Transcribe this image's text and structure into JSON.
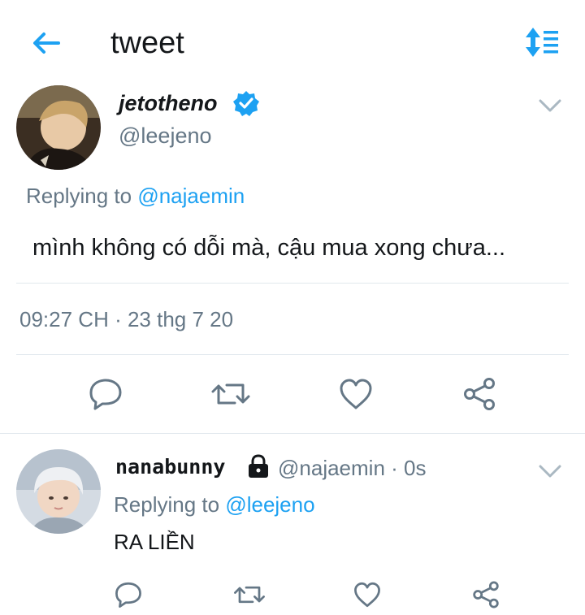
{
  "header": {
    "title": "tweet",
    "back_icon": "back-arrow-icon",
    "sort_icon": "sort-icon",
    "accent_color": "#1da1f2"
  },
  "tweet": {
    "display_name": "jetotheno",
    "handle": "@leejeno",
    "verified": true,
    "replying_prefix": "Replying to ",
    "replying_to": "@najaemin",
    "text": "mình không có dỗi mà, cậu mua xong chưa...",
    "timestamp": "09:27 CH · 23 thg 7 20",
    "actions": [
      "reply-icon",
      "retweet-icon",
      "like-icon",
      "share-icon"
    ]
  },
  "reply": {
    "display_name": "nanabunny",
    "protected": true,
    "handle_time": "@najaemin · 0s",
    "replying_prefix": "Replying to ",
    "replying_to": "@leejeno",
    "text": "RA LIỀN",
    "actions": [
      "reply-icon",
      "retweet-icon",
      "like-icon",
      "share-icon"
    ]
  },
  "colors": {
    "text": "#14171a",
    "secondary": "#657786",
    "link": "#1da1f2",
    "divider": "#e1e8ed"
  }
}
